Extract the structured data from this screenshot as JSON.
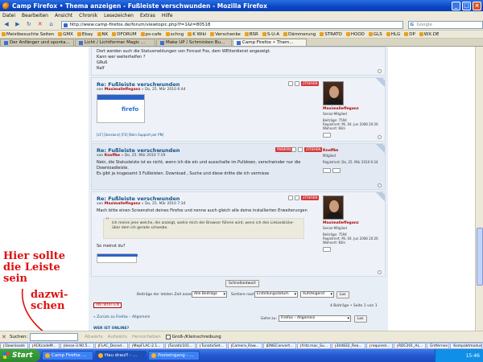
{
  "window": {
    "title": "Camp Firefox • Thema anzeigen - Fußleiste verschwunden - Mozilla Firefox"
  },
  "menu": [
    "Datei",
    "Bearbeiten",
    "Ansicht",
    "Chronik",
    "Lesezeichen",
    "Extras",
    "Hilfe"
  ],
  "nav": {
    "url": "http://www.camp-firefox.de/forum/viewtopic.php?f=1&t=80518",
    "search_placeholder": "Google"
  },
  "bookmarks": [
    "Meistbesuchte Seiten",
    "GMX",
    "Ebay",
    "NK",
    "DFORUM",
    "ps-cafe",
    "xchng",
    "K Wiki",
    "Verschenke",
    "BSR",
    "S-U-A",
    "Dämmerung",
    "STRATO",
    "HOOD",
    "GLS",
    "HLG",
    "DP",
    "WX.DE"
  ],
  "tabs": [
    "Der Anfänger und sponta...",
    "Licht / Lichtformer Magic ...",
    "Make UP / Schminken Bu...",
    "Camp Firefox • Them..."
  ],
  "posts": {
    "p0": {
      "line1": "Dort werden such die Statusmeldungen von Forcast Fox, dem WEtterdienst angezeigt.",
      "line2": "Kann wer weiterhelfen ?",
      "line3": "GRuß",
      "line4": "Ralf"
    },
    "p1": {
      "title": "Re: Fußleiste verschwunden",
      "meta_prefix": "von",
      "author": "Maximalleffeganz",
      "date": "» Do, 25. Mär 2010 6:44",
      "quote": "ZITIEREN",
      "rank": "Senior-Mitglied",
      "stats": "Beiträge: 7594",
      "reg": "Registriert: Mi, 04. Jun 2008 20:26",
      "loc": "Wohnort: Köln",
      "sig": "[LF] [Sessions] [FS] [Kein Support per PN]"
    },
    "p2": {
      "title": "Re: Fußleiste verschwunden",
      "meta_prefix": "von",
      "author": "Knoffke",
      "date": "» Do, 25. Mär 2010 7:19",
      "edit": "ÄNDERN",
      "quote": "ZITIEREN",
      "text1": "Nein, die Statusleiste ist es nicht, wenn ich die ein und ausschalte im Pulldown, verschwinder nur die Downloadleiste.",
      "text2": "Es gibt ja insgesamt 3 Fußleisten. Download , Suche und diese dritte die ich vermisse",
      "uname": "Knoffke",
      "rank": "Mitglied",
      "reg": "Registriert: Do, 25. Mär 2010 6:34"
    },
    "p3": {
      "title": "Re: Fußleiste verschwunden",
      "meta_prefix": "von",
      "author": "Maximalleffeganz",
      "date": "» Do, 25. Mär 2010 7:34",
      "quote": "ZITIEREN",
      "text1": "Mach bitte einen Screenshot deines Firefox und nenne auch gleich alle deine installierten Erweiterungen",
      "blockquote": "Ich meine jene welche, die anzeigt, wohin mich der Browser führen wird, wenn ich den Linkanklicke- über dem ich gerade schwebe.",
      "text2": "So meinst du?",
      "rank": "Senior-Mitglied",
      "stats": "Beiträge: 7594",
      "reg": "Registriert: Mi, 04. Jun 2008 20:26",
      "loc": "Wohnort: Köln"
    }
  },
  "controls": {
    "dispbtn": "Schnellantwort",
    "show_label": "Beiträge der letzten Zeit anzeigen:",
    "sel1": "Alle Beiträge",
    "sort_label": "Sortiere nach",
    "sel2": "Erstellungsdatum",
    "sel3": "Aufsteigend",
    "go": "Los",
    "answer": "ANTWORTEN",
    "count": "4 Beiträge • Seite 1 von 1",
    "back": "« Zurück zu Firefox – Allgemein",
    "jump_label": "Gehe zu:",
    "jump_sel": "Firefox – Allgemein",
    "jump_go": "Los",
    "whoonline": "WER IST ONLINE?"
  },
  "annotation": {
    "line1": "Hier sollte",
    "line2": "die Leiste",
    "line3": "sein",
    "line4": "dazwi-",
    "line5": "schen"
  },
  "findbar": {
    "label": "Suchen:",
    "next": "Abwärts",
    "prev": "Aufwärts",
    "highlight": "Hervorheben",
    "match_case": "Groß-/Kleinschreibung"
  },
  "taskrow": [
    "Downloads",
    "ACKcodeM...",
    "lense-3.90.5...",
    "FLAC_Decod...",
    "MepFLAC-2.1...",
    "Tunatic101...",
    "TunaticSet...",
    "Camera_Raw...",
    "DNGConvert...",
    "fritz.mac_Su...",
    "304832_Rea...",
    "required...",
    "RDC201_AL...",
    "Entfernen",
    "Kompaktmodus"
  ],
  "taskbar": {
    "start": "Start",
    "items": [
      "Camp Firefox ...",
      "Hau drauf! - ...",
      "Posteingang - ..."
    ],
    "clock": "15:46"
  },
  "colors": {
    "accent": "#105289",
    "author": "#aa0000",
    "annotation": "#e01010"
  }
}
